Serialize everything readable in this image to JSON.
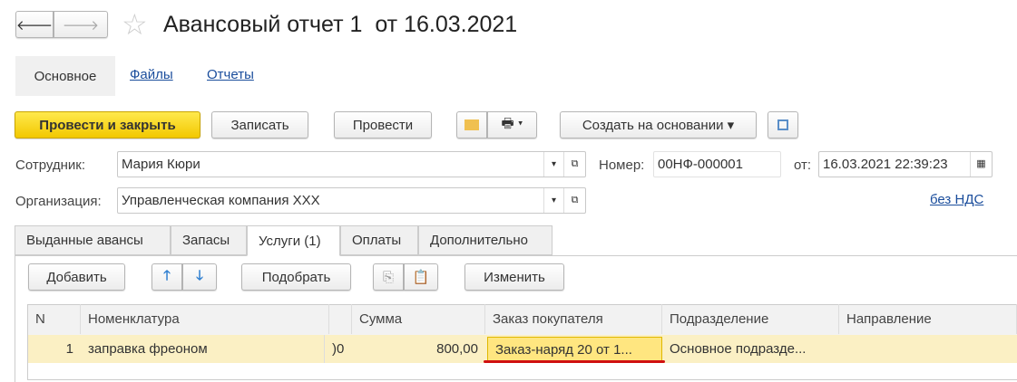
{
  "header": {
    "title": "Авансовый отчет 1  от 16.03.2021",
    "back_icon": "arrow-left",
    "forward_icon": "arrow-right",
    "favorite_icon": "star"
  },
  "nav": [
    {
      "label": "Основное",
      "active": true
    },
    {
      "label": "Файлы"
    },
    {
      "label": "Отчеты"
    }
  ],
  "toolbar": {
    "post_close": "Провести и закрыть",
    "save": "Записать",
    "post": "Провести",
    "create_based": "Создать на основании",
    "accent": "#f5d000"
  },
  "form": {
    "employee_label": "Сотрудник:",
    "employee": "Мария Кюри",
    "number_label": "Номер:",
    "number": "00НФ-000001",
    "date_label": "от:",
    "date": "16.03.2021 22:39:23",
    "org_label": "Организация:",
    "org": "Управленческая компания XXX",
    "vat_link": "без НДС"
  },
  "tabs": [
    {
      "label": "Выданные авансы"
    },
    {
      "label": "Запасы"
    },
    {
      "label": "Услуги (1)",
      "active": true
    },
    {
      "label": "Оплаты"
    },
    {
      "label": "Дополнительно"
    }
  ],
  "table_toolbar": {
    "add": "Добавить",
    "pick": "Подобрать",
    "change": "Изменить"
  },
  "table": {
    "columns": [
      "N",
      "Номенклатура",
      "Сумма",
      "Заказ покупателя",
      "Подразделение",
      "Направление"
    ],
    "rows": [
      {
        "n": "1",
        "item": "заправка фреоном",
        "partial": ")0",
        "sum": "800,00",
        "order": "Заказ-наряд 20 от 1...",
        "dept": "Основное подразде...",
        "direction": ""
      }
    ]
  }
}
